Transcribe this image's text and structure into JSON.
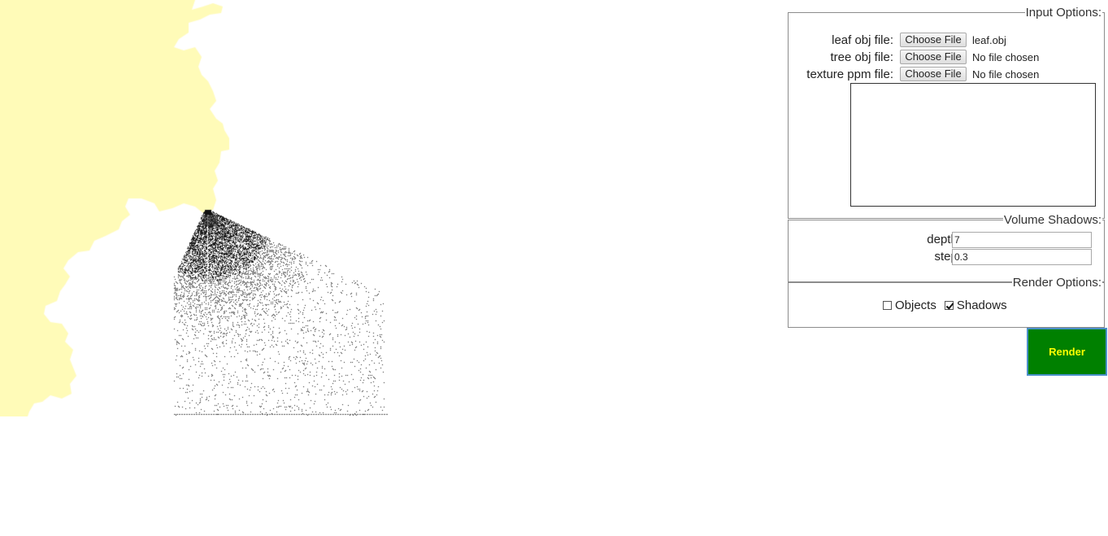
{
  "input_options": {
    "legend": "Input Options:",
    "leaf_label": "leaf obj file:",
    "leaf_button": "Choose File",
    "leaf_file": "leaf.obj",
    "tree_label": "tree obj file:",
    "tree_button": "Choose File",
    "tree_file": "No file chosen",
    "texture_label": "texture ppm file:",
    "texture_button": "Choose File",
    "texture_file": "No file chosen"
  },
  "volume_shadows": {
    "legend": "Volume Shadows:",
    "depth_label": "depth:",
    "depth_value": "7",
    "step_label": "step:",
    "step_value": "0.3"
  },
  "render_options": {
    "legend": "Render Options:",
    "objects_label": "Objects",
    "objects_checked": false,
    "shadows_label": "Shadows",
    "shadows_checked": true
  },
  "render_button": "Render",
  "colors": {
    "fractal_fill": "#fffbb8",
    "render_button_bg": "#008000",
    "render_button_text": "#ffff00"
  }
}
